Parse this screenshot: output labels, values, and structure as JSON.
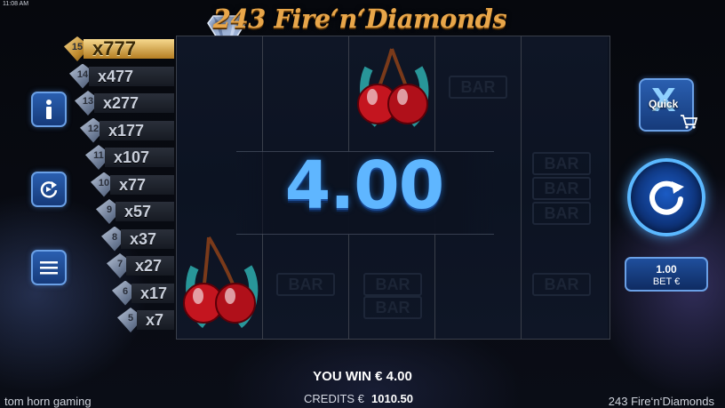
{
  "status": {
    "time": "11:08 AM"
  },
  "game": {
    "title": "243 Fire‘n‘Diamonds"
  },
  "paytable": [
    {
      "count": "15",
      "mult": "x777"
    },
    {
      "count": "14",
      "mult": "x477"
    },
    {
      "count": "13",
      "mult": "x277"
    },
    {
      "count": "12",
      "mult": "x177"
    },
    {
      "count": "11",
      "mult": "x107"
    },
    {
      "count": "10",
      "mult": "x77"
    },
    {
      "count": "9",
      "mult": "x57"
    },
    {
      "count": "8",
      "mult": "x37"
    },
    {
      "count": "7",
      "mult": "x27"
    },
    {
      "count": "6",
      "mult": "x17"
    },
    {
      "count": "5",
      "mult": "x7"
    }
  ],
  "reels": {
    "bar_label": "BAR"
  },
  "win": {
    "amount": "4.00"
  },
  "controls": {
    "quick_label": "Quick",
    "bet_value": "1.00",
    "bet_label": "BET €"
  },
  "footer": {
    "you_win": "YOU WIN € 4.00",
    "credits_label": "CREDITS €",
    "credits_value": "1010.50",
    "brand": "tom horn gaming",
    "game_name": "243 Fire‘n‘Diamonds"
  },
  "colors": {
    "accent_blue": "#5fb6ff",
    "gold": "#e8a64a",
    "button_blue": "#2a5fb0"
  },
  "icons": [
    "info-icon",
    "autoplay-icon",
    "menu-icon",
    "quick-spin-icon",
    "cart-icon",
    "spin-icon"
  ]
}
